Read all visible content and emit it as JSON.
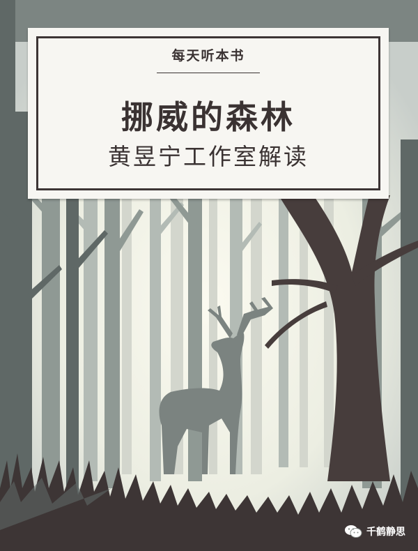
{
  "cover": {
    "series_label": "每天听本书",
    "title": "挪威的森林",
    "subtitle": "黄昱宁工作室解读",
    "illustration": "deer-in-misty-forest"
  },
  "watermark": {
    "text": "千鹤静思",
    "icon": "wechat-icon"
  },
  "colors": {
    "mist": "#f3f2e6",
    "far_trees": "#c9cdc4",
    "mid_trees": "#8f9994",
    "near_trees": "#5f6866",
    "deer": "#7b8380",
    "dark_tree": "#473d3c",
    "text": "#3a3232"
  }
}
